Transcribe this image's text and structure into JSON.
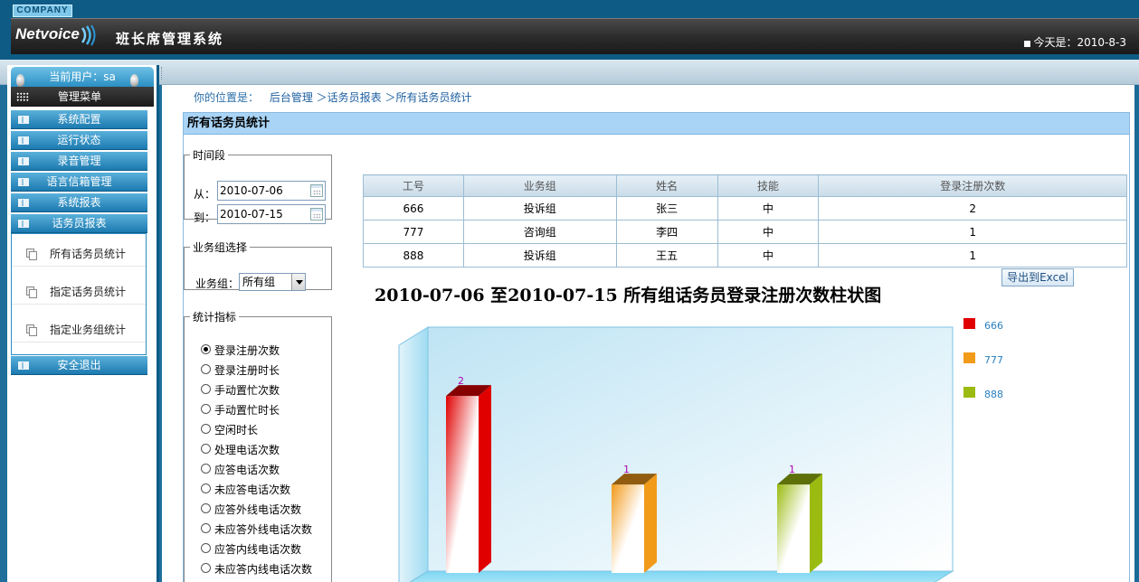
{
  "header": {
    "company": "COMPANY",
    "logo": "Netvoice",
    "title": "班长席管理系统",
    "today_label": "今天是：2010-8-3"
  },
  "sidebar": {
    "current_user": "当前用户：sa",
    "menu_head": "管理菜单",
    "items": [
      {
        "label": "系统配置"
      },
      {
        "label": "运行状态"
      },
      {
        "label": "录音管理"
      },
      {
        "label": "语言信箱管理"
      },
      {
        "label": "系统报表"
      },
      {
        "label": "话务员报表"
      }
    ],
    "submenu": [
      {
        "label": "所有话务员统计"
      },
      {
        "label": "指定话务员统计"
      },
      {
        "label": "指定业务组统计"
      }
    ],
    "logout": "安全退出"
  },
  "breadcrumb": {
    "label": "你的位置是：",
    "path": "后台管理 ＞话务员报表 ＞所有话务员统计"
  },
  "panel": {
    "title": "所有话务员统计",
    "time_legend": "时间段",
    "from_label": "从：",
    "from_value": "2010-07-06",
    "to_label": "到：",
    "to_value": "2010-07-15",
    "group_legend": "业务组选择",
    "group_label": "业务组：",
    "group_value": "所有组",
    "metric_legend": "统计指标",
    "metrics": [
      {
        "label": "登录注册次数",
        "checked": true
      },
      {
        "label": "登录注册时长",
        "checked": false
      },
      {
        "label": "手动置忙次数",
        "checked": false
      },
      {
        "label": "手动置忙时长",
        "checked": false
      },
      {
        "label": "空闲时长",
        "checked": false
      },
      {
        "label": "处理电话次数",
        "checked": false
      },
      {
        "label": "应答电话次数",
        "checked": false
      },
      {
        "label": "未应答电话次数",
        "checked": false
      },
      {
        "label": "应答外线电话次数",
        "checked": false
      },
      {
        "label": "未应答外线电话次数",
        "checked": false
      },
      {
        "label": "应答内线电话次数",
        "checked": false
      },
      {
        "label": "未应答内线电话次数",
        "checked": false
      }
    ]
  },
  "table": {
    "headers": [
      "工号",
      "业务组",
      "姓名",
      "技能",
      "登录注册次数"
    ],
    "rows": [
      [
        "666",
        "投诉组",
        "张三",
        "中",
        "2"
      ],
      [
        "777",
        "咨询组",
        "李四",
        "中",
        "1"
      ],
      [
        "888",
        "投诉组",
        "王五",
        "中",
        "1"
      ]
    ]
  },
  "export_button": "导出到Excel",
  "chart_data": {
    "type": "bar",
    "title": "2010-07-06 至2010-07-15 所有组话务员登录注册次数柱状图",
    "categories": [
      "666",
      "777",
      "888"
    ],
    "values": [
      2,
      1,
      1
    ],
    "colors": [
      "#e00000",
      "#f29a1a",
      "#9bbb10"
    ],
    "legend": [
      "666",
      "777",
      "888"
    ],
    "legend_position": "right",
    "ylim": [
      0,
      2.4
    ]
  }
}
